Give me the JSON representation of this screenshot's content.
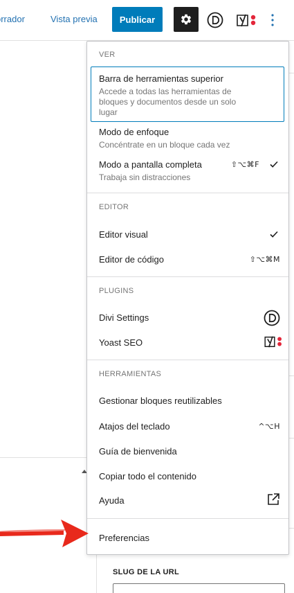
{
  "toolbar": {
    "save_draft_label": "Guardar borrador",
    "save_draft_visible": "orrador",
    "preview_label": "Vista previa",
    "publish_label": "Publicar",
    "settings_icon": "gear-icon",
    "divi_icon": "divi-icon",
    "yoast_icon": "yoast-icon",
    "more_icon": "more-vertical-icon"
  },
  "menu": {
    "ver": {
      "title": "Ver",
      "items": [
        {
          "label": "Barra de herramientas superior",
          "description": "Accede a todas las herramientas de bloques y documentos desde un solo lugar",
          "active": true
        },
        {
          "label": "Modo de enfoque",
          "description": "Concéntrate en un bloque cada vez"
        },
        {
          "label": "Modo a pantalla completa",
          "description": "Trabaja sin distracciones",
          "shortcut": "⇧⌥⌘F",
          "checked": true
        }
      ]
    },
    "editor": {
      "title": "Editor",
      "items": [
        {
          "label": "Editor visual",
          "checked": true
        },
        {
          "label": "Editor de código",
          "shortcut": "⇧⌥⌘M"
        }
      ]
    },
    "plugins": {
      "title": "Plugins",
      "items": [
        {
          "label": "Divi Settings",
          "icon": "divi-icon"
        },
        {
          "label": "Yoast SEO",
          "icon": "yoast-icon"
        }
      ]
    },
    "herramientas": {
      "title": "Herramientas",
      "items": [
        {
          "label": "Gestionar bloques reutilizables"
        },
        {
          "label": "Atajos del teclado",
          "shortcut": "^⌥H"
        },
        {
          "label": "Guía de bienvenida"
        },
        {
          "label": "Copiar todo el contenido"
        },
        {
          "label": "Ayuda",
          "icon": "external-link-icon"
        }
      ]
    },
    "preferences": {
      "label": "Preferencias"
    }
  },
  "sidebar": {
    "slug_label": "Slug de la URL"
  },
  "colors": {
    "accent": "#007cba",
    "link": "#2271b1",
    "annotation_red": "#e8291c",
    "dark": "#1e1e1e",
    "muted": "#757575"
  }
}
